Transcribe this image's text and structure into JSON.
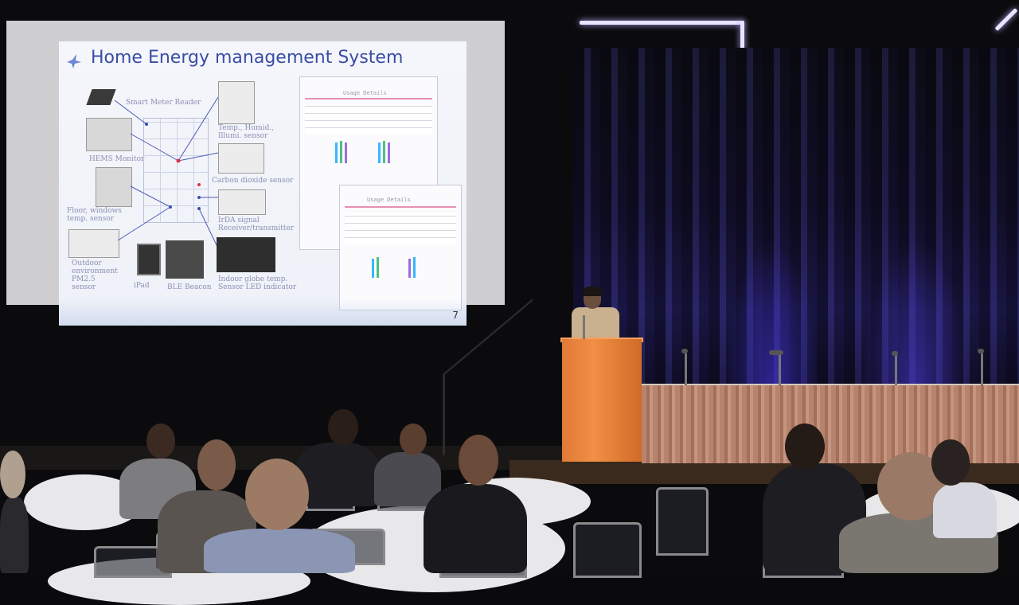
{
  "slide": {
    "title": "Home Energy management System",
    "page_number": "7",
    "captions": {
      "smart_meter": "Smart Meter Reader",
      "hems_monitor": "HEMS Monitor",
      "floor_sensor": "Floor, windows temp. sensor",
      "outdoor": "Outdoor environment PM2.5 sensor",
      "ipad": "iPad",
      "ble": "BLE Beacon",
      "temp_humid": "Temp., Humid., Illumi. sensor",
      "co2": "Carbon dioxide sensor",
      "irda": "IrDA signal Receiver/transmitter",
      "globe": "Indoor globe temp. Sensor LED indicator"
    },
    "usage_panel_title": "Usage Details",
    "usage_panel_title_2": "Usage Details"
  },
  "colors": {
    "slide_title": "#3a4da6",
    "podium": "#f08f45",
    "curtain_light": "#2a2470",
    "table_skirt": "#b7836c"
  }
}
